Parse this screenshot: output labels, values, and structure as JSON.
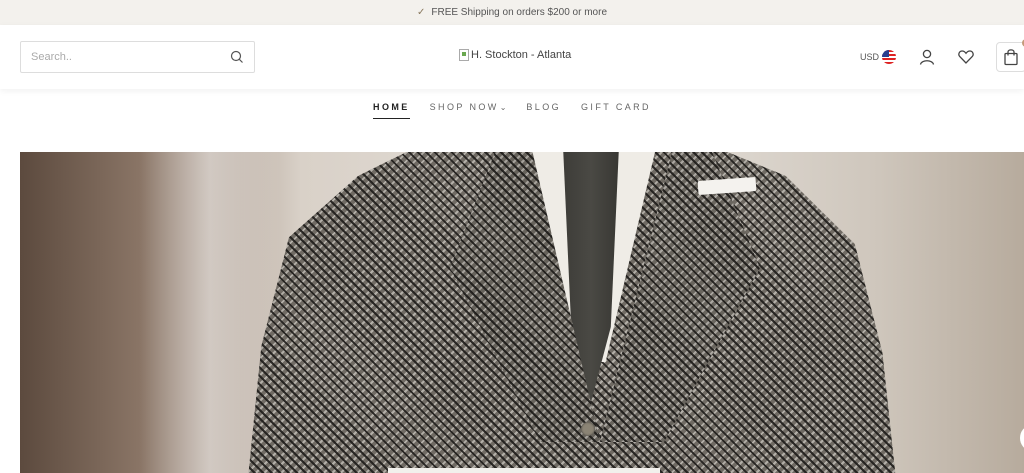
{
  "announcement": {
    "text": "FREE Shipping on orders $200 or more",
    "icon": "check-icon"
  },
  "header": {
    "search": {
      "placeholder": "Search..",
      "icon": "search-icon"
    },
    "logo_alt": "H. Stockton - Atlanta",
    "currency": "USD",
    "icons": [
      "account-icon",
      "heart-icon",
      "shopping-bag-icon"
    ]
  },
  "nav": {
    "items": [
      {
        "label": "HOME",
        "active": true
      },
      {
        "label": "SHOP NOW",
        "dropdown": true
      },
      {
        "label": "BLOG"
      },
      {
        "label": "GIFT CARD"
      }
    ]
  },
  "colors": {
    "announcement_bg": "#f3f1ed",
    "accent": "#c49a7a"
  }
}
